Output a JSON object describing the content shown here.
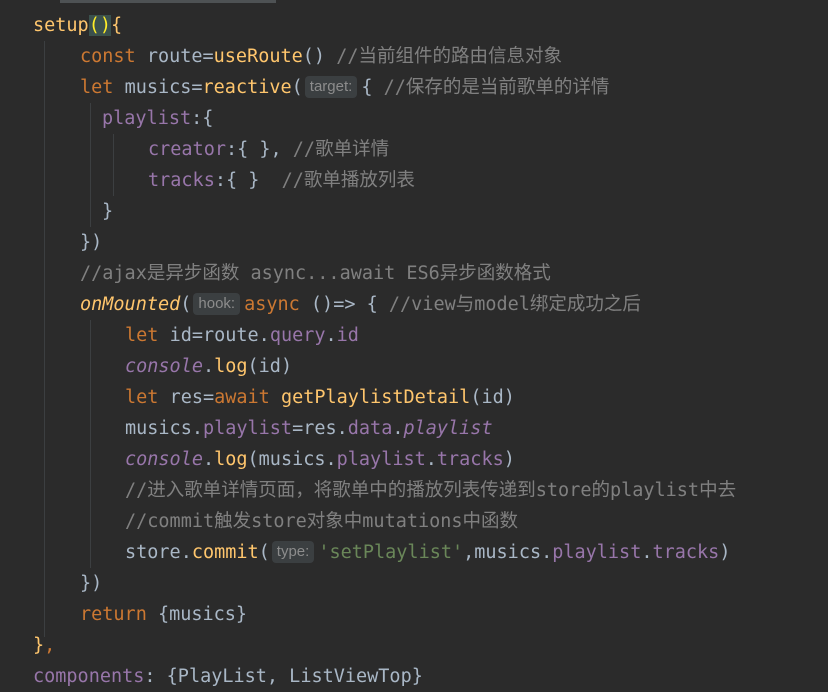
{
  "editor": {
    "lines": [
      [
        {
          "t": "setup",
          "c": "fn"
        },
        {
          "t": "()",
          "c": "paren-hl"
        },
        {
          "t": "{",
          "c": "fn"
        }
      ],
      [
        {
          "t": "const ",
          "c": "kw"
        },
        {
          "t": "route=",
          "c": "plain"
        },
        {
          "t": "useRoute",
          "c": "fn"
        },
        {
          "t": "() ",
          "c": "plain"
        },
        {
          "t": "//当前组件的路由信息对象",
          "c": "cmt"
        }
      ],
      [
        {
          "t": "let ",
          "c": "kw"
        },
        {
          "t": "musics=",
          "c": "plain"
        },
        {
          "t": "reactive",
          "c": "fn"
        },
        {
          "t": "(",
          "c": "plain"
        },
        {
          "hint": "target:"
        },
        {
          "t": "{ ",
          "c": "plain"
        },
        {
          "t": "//保存的是当前歌单的详情",
          "c": "cmt"
        }
      ],
      [
        {
          "t": "playlist",
          "c": "prop"
        },
        {
          "t": ":{",
          "c": "plain"
        }
      ],
      [
        {
          "t": "creator",
          "c": "prop"
        },
        {
          "t": ":{ }, ",
          "c": "plain"
        },
        {
          "t": "//歌单详情",
          "c": "cmt"
        }
      ],
      [
        {
          "t": "tracks",
          "c": "prop"
        },
        {
          "t": ":{ }  ",
          "c": "plain"
        },
        {
          "t": "//歌单播放列表",
          "c": "cmt"
        }
      ],
      [
        {
          "t": "}",
          "c": "plain"
        }
      ],
      [
        {
          "t": "})",
          "c": "plain"
        }
      ],
      [
        {
          "t": "//ajax是异步函数 async...await ES6异步函数格式",
          "c": "cmt"
        }
      ],
      [
        {
          "t": "onMounted",
          "c": "italic-fn"
        },
        {
          "t": "(",
          "c": "plain"
        },
        {
          "hint": "hook:"
        },
        {
          "t": "async ",
          "c": "kw"
        },
        {
          "t": "()=> { ",
          "c": "plain"
        },
        {
          "t": "//view与model绑定成功之后",
          "c": "cmt"
        }
      ],
      [
        {
          "t": "let ",
          "c": "kw"
        },
        {
          "t": "id=route.",
          "c": "plain"
        },
        {
          "t": "query",
          "c": "prop"
        },
        {
          "t": ".",
          "c": "plain"
        },
        {
          "t": "id",
          "c": "prop"
        }
      ],
      [
        {
          "t": "console",
          "c": "italic-log"
        },
        {
          "t": ".",
          "c": "plain"
        },
        {
          "t": "log",
          "c": "fn"
        },
        {
          "t": "(id)",
          "c": "plain"
        }
      ],
      [
        {
          "t": "let ",
          "c": "kw"
        },
        {
          "t": "res=",
          "c": "plain"
        },
        {
          "t": "await ",
          "c": "kw"
        },
        {
          "t": "getPlaylistDetail",
          "c": "fn"
        },
        {
          "t": "(id)",
          "c": "plain"
        }
      ],
      [
        {
          "t": "musics.",
          "c": "plain"
        },
        {
          "t": "playlist",
          "c": "prop"
        },
        {
          "t": "=res.",
          "c": "plain"
        },
        {
          "t": "data",
          "c": "prop"
        },
        {
          "t": ".",
          "c": "plain"
        },
        {
          "t": "playlist",
          "c": "italic-prop"
        }
      ],
      [
        {
          "t": "console",
          "c": "italic-log"
        },
        {
          "t": ".",
          "c": "plain"
        },
        {
          "t": "log",
          "c": "fn"
        },
        {
          "t": "(musics.",
          "c": "plain"
        },
        {
          "t": "playlist",
          "c": "prop"
        },
        {
          "t": ".",
          "c": "plain"
        },
        {
          "t": "tracks",
          "c": "prop"
        },
        {
          "t": ")",
          "c": "plain"
        }
      ],
      [
        {
          "t": "//进入歌单详情页面，将歌单中的播放列表传递到store的playlist中去",
          "c": "cmt"
        }
      ],
      [
        {
          "t": "//commit触发store对象中mutations中函数",
          "c": "cmt"
        }
      ],
      [
        {
          "t": "store.",
          "c": "plain"
        },
        {
          "t": "commit",
          "c": "fn"
        },
        {
          "t": "(",
          "c": "plain"
        },
        {
          "hint": "type:"
        },
        {
          "t": "'setPlaylist'",
          "c": "str"
        },
        {
          "t": ",musics.",
          "c": "plain"
        },
        {
          "t": "playlist",
          "c": "prop"
        },
        {
          "t": ".",
          "c": "plain"
        },
        {
          "t": "tracks",
          "c": "prop"
        },
        {
          "t": ")",
          "c": "plain"
        }
      ],
      [
        {
          "t": "})",
          "c": "plain"
        }
      ],
      [
        {
          "t": "return ",
          "c": "kw"
        },
        {
          "t": "{musics}",
          "c": "plain"
        }
      ],
      [
        {
          "t": "}",
          "c": "fn"
        },
        {
          "t": ",",
          "c": "kw"
        }
      ],
      [
        {
          "t": "components",
          "c": "prop"
        },
        {
          "t": ": {PlayList, ListViewTop}",
          "c": "plain"
        }
      ]
    ]
  }
}
